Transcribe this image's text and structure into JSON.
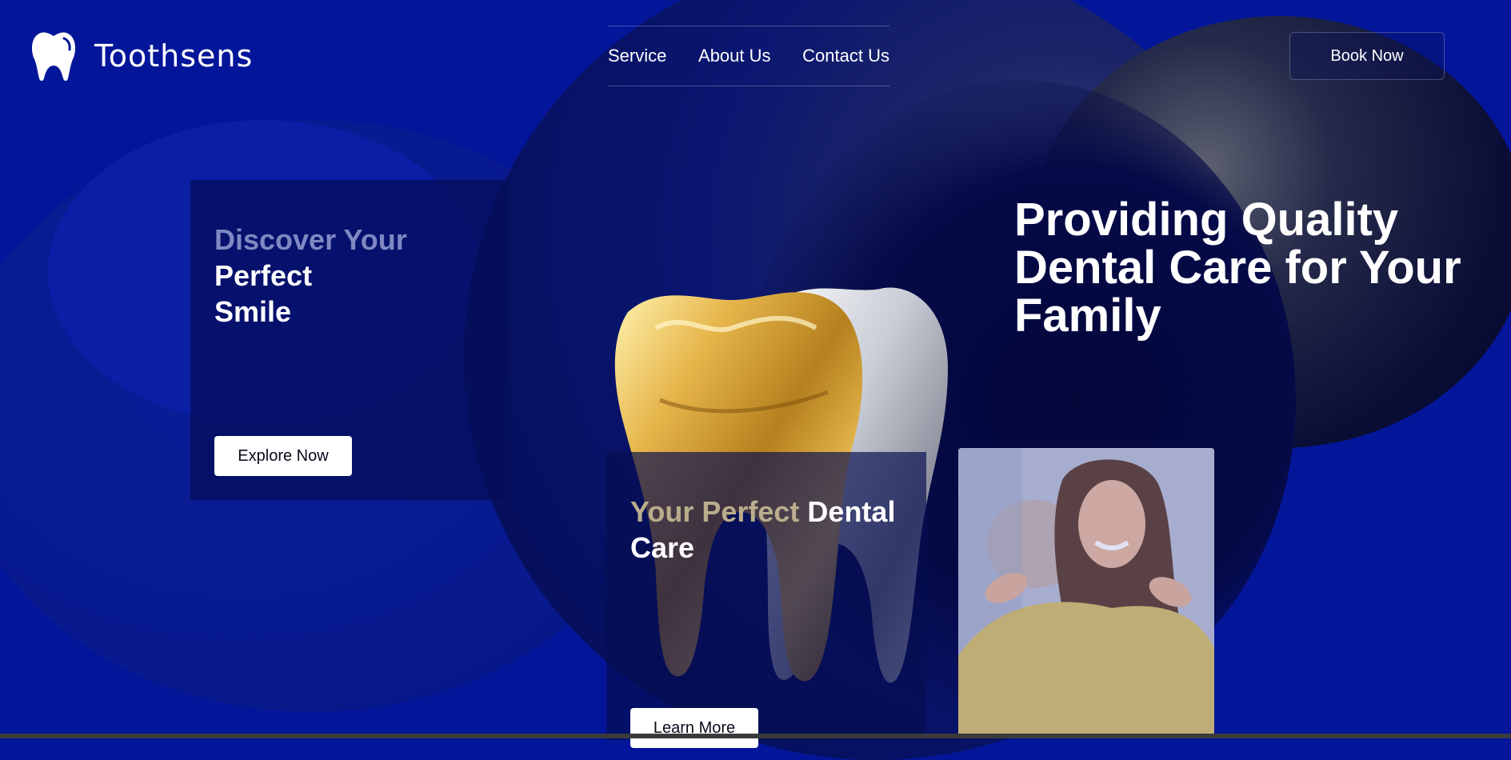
{
  "brand": {
    "name": "Toothsens",
    "logo_icon": "tooth-icon"
  },
  "nav": {
    "items": [
      "Service",
      "About Us",
      "Contact Us"
    ]
  },
  "header": {
    "book_label": "Book Now"
  },
  "discover_card": {
    "title_dim": "Discover Your",
    "title_bright_1": "Perfect",
    "title_bright_2": "Smile",
    "button_label": "Explore Now"
  },
  "dental_card": {
    "title_dim": "Your Perfect",
    "title_bright_1": "Dental",
    "title_bright_2": "Care",
    "button_label": "Learn More"
  },
  "hero": {
    "headline_line1": "Providing Quality",
    "headline_line2": "Dental Care for Your",
    "headline_line3": "Family"
  },
  "colors": {
    "background": "#03169a",
    "gold": "#d9ab3a",
    "silver": "#c9ccd6"
  }
}
